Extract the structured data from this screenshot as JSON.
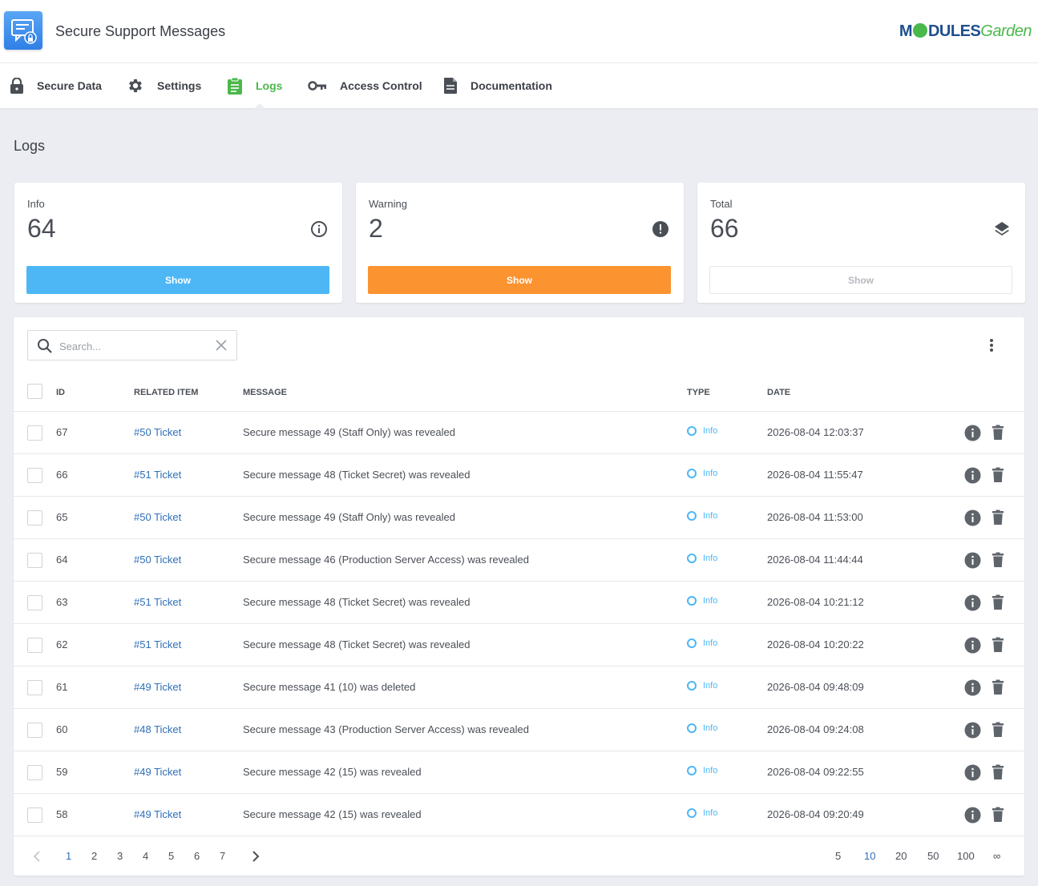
{
  "header": {
    "title": "Secure Support Messages",
    "brand_part1": "M",
    "brand_part2": "DULES",
    "brand_part3": "Garden"
  },
  "nav": [
    {
      "label": "Secure Data",
      "icon": "lock-icon"
    },
    {
      "label": "Settings",
      "icon": "gear-icon"
    },
    {
      "label": "Logs",
      "icon": "clipboard-icon",
      "active": true
    },
    {
      "label": "Access Control",
      "icon": "key-icon"
    },
    {
      "label": "Documentation",
      "icon": "document-icon"
    }
  ],
  "page": {
    "title": "Logs"
  },
  "stats": [
    {
      "label": "Info",
      "value": "64",
      "button": "Show",
      "icon": "info-circle-icon",
      "color": "#4db7f5"
    },
    {
      "label": "Warning",
      "value": "2",
      "button": "Show",
      "icon": "alert-circle-icon",
      "color": "#fc9331"
    },
    {
      "label": "Total",
      "value": "66",
      "button": "Show",
      "icon": "layers-icon"
    }
  ],
  "search": {
    "placeholder": "Search..."
  },
  "table": {
    "headers": {
      "id": "ID",
      "related": "RELATED ITEM",
      "message": "MESSAGE",
      "type": "TYPE",
      "date": "DATE"
    },
    "rows": [
      {
        "id": "67",
        "related": "#50 Ticket",
        "message": "Secure message 49 (Staff Only) was revealed",
        "type": "Info",
        "date": "2026-08-04 12:03:37"
      },
      {
        "id": "66",
        "related": "#51 Ticket",
        "message": "Secure message 48 (Ticket Secret) was revealed",
        "type": "Info",
        "date": "2026-08-04 11:55:47"
      },
      {
        "id": "65",
        "related": "#50 Ticket",
        "message": "Secure message 49 (Staff Only) was revealed",
        "type": "Info",
        "date": "2026-08-04 11:53:00"
      },
      {
        "id": "64",
        "related": "#50 Ticket",
        "message": "Secure message 46 (Production Server Access) was revealed",
        "type": "Info",
        "date": "2026-08-04 11:44:44"
      },
      {
        "id": "63",
        "related": "#51 Ticket",
        "message": "Secure message 48 (Ticket Secret) was revealed",
        "type": "Info",
        "date": "2026-08-04 10:21:12"
      },
      {
        "id": "62",
        "related": "#51 Ticket",
        "message": "Secure message 48 (Ticket Secret) was revealed",
        "type": "Info",
        "date": "2026-08-04 10:20:22"
      },
      {
        "id": "61",
        "related": "#49 Ticket",
        "message": "Secure message 41 (10) was deleted",
        "type": "Info",
        "date": "2026-08-04 09:48:09"
      },
      {
        "id": "60",
        "related": "#48 Ticket",
        "message": "Secure message 43 (Production Server Access) was revealed",
        "type": "Info",
        "date": "2026-08-04 09:24:08"
      },
      {
        "id": "59",
        "related": "#49 Ticket",
        "message": "Secure message 42 (15) was revealed",
        "type": "Info",
        "date": "2026-08-04 09:22:55"
      },
      {
        "id": "58",
        "related": "#49 Ticket",
        "message": "Secure message 42 (15) was revealed",
        "type": "Info",
        "date": "2026-08-04 09:20:49"
      }
    ]
  },
  "pagination": {
    "pages": [
      "1",
      "2",
      "3",
      "4",
      "5",
      "6",
      "7"
    ],
    "current_page": "1",
    "per_page": [
      "5",
      "10",
      "20",
      "50",
      "100",
      "∞"
    ],
    "current_per_page": "10"
  }
}
